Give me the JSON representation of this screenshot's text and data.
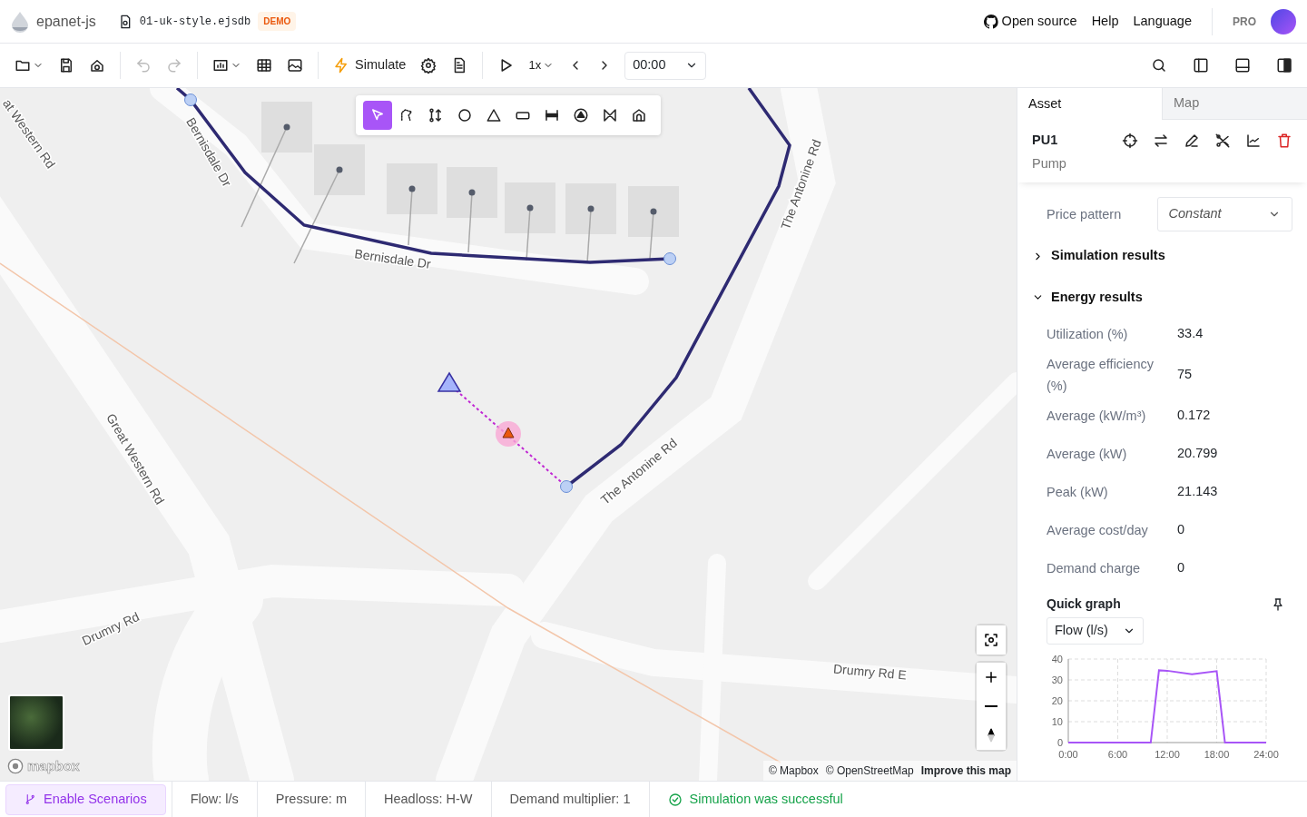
{
  "header": {
    "app_name": "epanet-js",
    "file_name": "01-uk-style.ejsdb",
    "badge": "DEMO",
    "links": [
      "Open source",
      "Help",
      "Language"
    ],
    "plan": "PRO"
  },
  "toolbar": {
    "simulate": "Simulate",
    "speed": "1x",
    "time": "00:00"
  },
  "map": {
    "tools": [
      {
        "kind": "select",
        "selected": true
      },
      {
        "kind": "lasso",
        "selected": false
      },
      {
        "kind": "connect",
        "selected": false
      },
      {
        "kind": "junction",
        "selected": false
      },
      {
        "kind": "reservoir",
        "selected": false
      },
      {
        "kind": "tank",
        "selected": false
      },
      {
        "kind": "pipe",
        "selected": false
      },
      {
        "kind": "pump",
        "selected": false
      },
      {
        "kind": "valve",
        "selected": false
      },
      {
        "kind": "customer",
        "selected": false
      }
    ],
    "street_labels": [
      "at Western Rd",
      "Bernisdale Dr",
      "Bernisdale Dr",
      "The Antonine Rd",
      "The Antonine Rd",
      "Great Western Rd",
      "Drumry Rd",
      "Drumry Rd E"
    ],
    "logo": "mapbox",
    "attribution": [
      "© Mapbox",
      "© OpenStreetMap"
    ],
    "improve_link": "Improve this map"
  },
  "panel": {
    "tabs": [
      {
        "label": "Asset",
        "selected": true
      },
      {
        "label": "Map",
        "selected": false
      }
    ],
    "asset_id": "PU1",
    "asset_type": "Pump",
    "price_pattern": {
      "label": "Price pattern",
      "value": "Constant"
    },
    "sections": [
      {
        "title": "Simulation results",
        "expanded": false
      },
      {
        "title": "Energy results",
        "expanded": true,
        "rows": [
          {
            "label": "Utilization (%)",
            "value": "33.4"
          },
          {
            "label": "Average efficiency (%)",
            "value": "75"
          },
          {
            "label": "Average (kW/m³)",
            "value": "0.172"
          },
          {
            "label": "Average (kW)",
            "value": "20.799"
          },
          {
            "label": "Peak (kW)",
            "value": "21.143"
          },
          {
            "label": "Average cost/day",
            "value": "0"
          },
          {
            "label": "Demand charge",
            "value": "0"
          }
        ]
      }
    ],
    "quick_graph": {
      "title": "Quick graph",
      "select": "Flow (l/s)",
      "chart_data": {
        "type": "line",
        "x": [
          0,
          10,
          11,
          12,
          15,
          18,
          19,
          24
        ],
        "series": [
          {
            "color": "#a855f7",
            "values": [
              0,
              0,
              34.6,
              34.4,
              32.7,
              34.2,
              0,
              0
            ]
          }
        ],
        "grid": true,
        "xlim": [
          0,
          24
        ],
        "ylim": [
          0,
          40
        ],
        "xticks": [
          {
            "value": 0,
            "label": "0:00"
          },
          {
            "value": 6,
            "label": "6:00"
          },
          {
            "value": 12,
            "label": "12:00"
          },
          {
            "value": 18,
            "label": "18:00"
          },
          {
            "value": 24,
            "label": "24:00"
          }
        ],
        "yticks": [
          0,
          10,
          20,
          30,
          40
        ]
      }
    }
  },
  "status_bar": {
    "scenarios_button": "Enable Scenarios",
    "items": [
      "Flow: l/s",
      "Pressure: m",
      "Headloss: H-W",
      "Demand multiplier: 1"
    ],
    "message": "Simulation was successful"
  }
}
